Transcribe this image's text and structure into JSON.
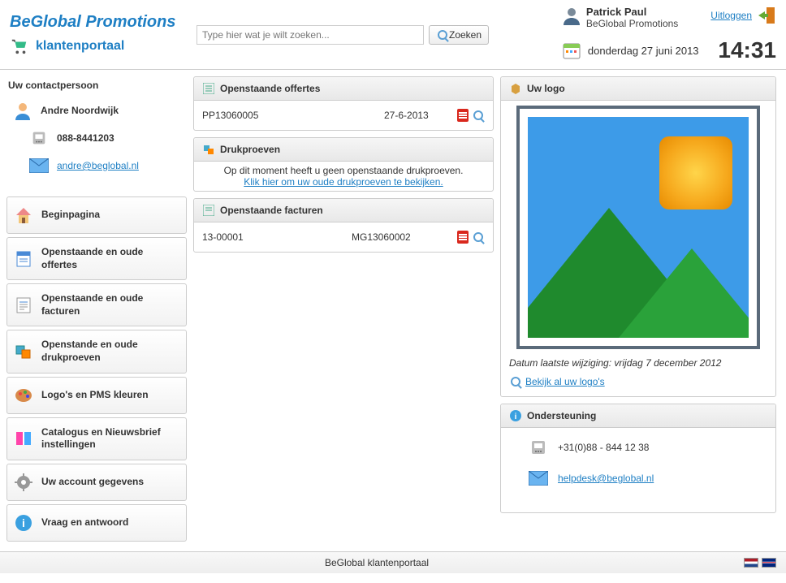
{
  "header": {
    "title": "BeGlobal Promotions",
    "subtitle": "klantenportaal",
    "search_placeholder": "Type hier wat je wilt zoeken...",
    "search_button": "Zoeken"
  },
  "user": {
    "name": "Patrick Paul",
    "company": "BeGlobal Promotions",
    "logout": "Uitloggen",
    "date": "donderdag 27 juni 2013",
    "time": "14:31"
  },
  "contact": {
    "heading": "Uw contactpersoon",
    "name": "Andre Noordwijk",
    "phone": "088-8441203",
    "email": "andre@beglobal.nl"
  },
  "nav": {
    "items": [
      "Beginpagina",
      "Openstaande en oude offertes",
      "Openstaande en oude facturen",
      "Openstande en oude drukproeven",
      "Logo's en PMS kleuren",
      "Catalogus en Nieuwsbrief instellingen",
      "Uw account gegevens",
      "Vraag en antwoord"
    ]
  },
  "offertes": {
    "title": "Openstaande offertes",
    "rows": [
      {
        "id": "PP13060005",
        "date": "27-6-2013"
      }
    ]
  },
  "drukproeven": {
    "title": "Drukproeven",
    "empty": "Op dit moment heeft u geen openstaande drukproeven.",
    "link": "Klik hier om uw oude drukproeven te bekijken."
  },
  "facturen": {
    "title": "Openstaande facturen",
    "rows": [
      {
        "id": "13-00001",
        "ref": "MG13060002"
      }
    ]
  },
  "logo": {
    "title": "Uw logo",
    "date": "Datum laatste wijziging: vrijdag 7 december 2012",
    "link": "Bekijk al uw logo's"
  },
  "support": {
    "title": "Ondersteuning",
    "phone": "+31(0)88 - 844 12 38",
    "email": "helpdesk@beglobal.nl"
  },
  "footer": {
    "text": "BeGlobal klantenportaal"
  }
}
